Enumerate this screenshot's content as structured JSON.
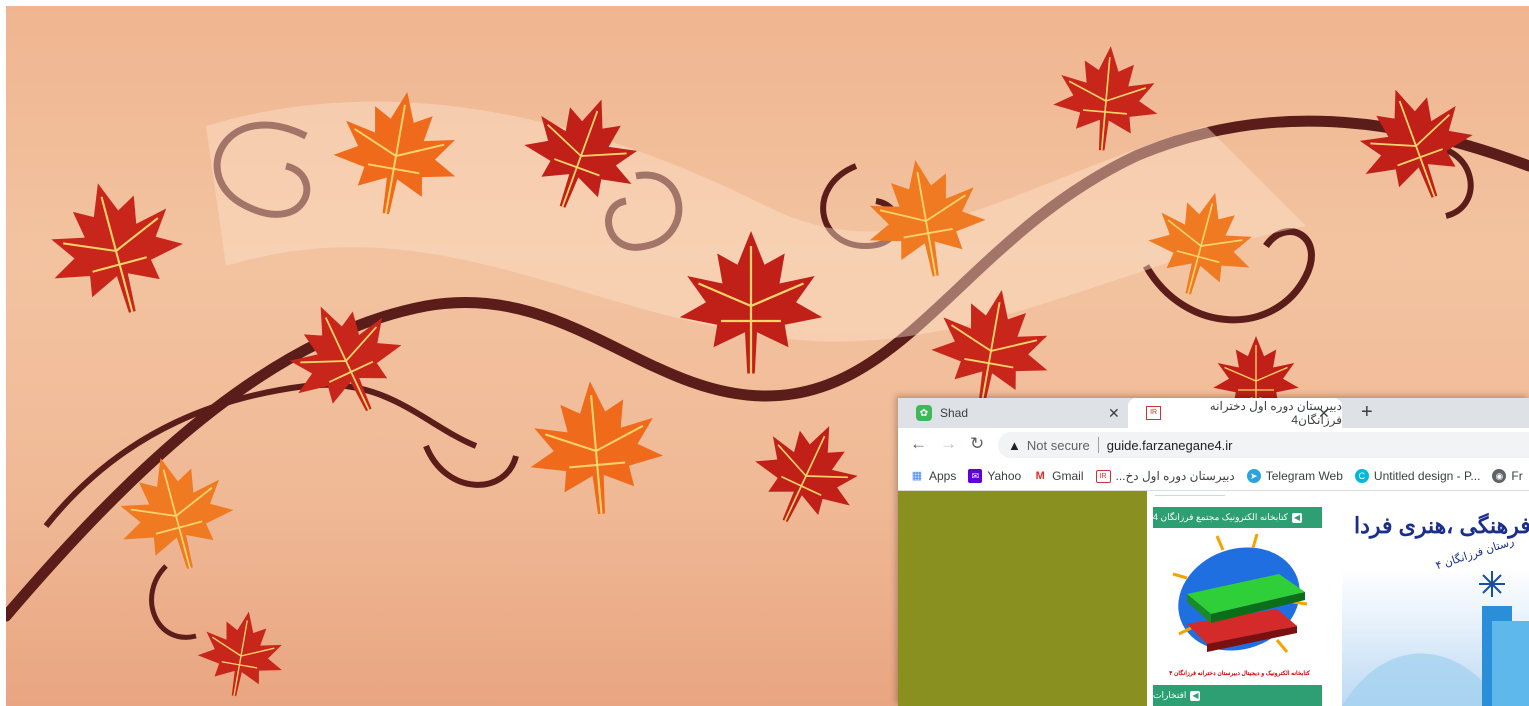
{
  "tabs": [
    {
      "title": "Shad",
      "active": false
    },
    {
      "title": "دبیرستان دوره اول دخترانه فرزانگان4",
      "active": true
    }
  ],
  "toolbar": {
    "security": "Not secure",
    "url": "guide.farzanegane4.ir"
  },
  "bookmarks": [
    {
      "label": "Apps",
      "icon": "apps-grid-icon"
    },
    {
      "label": "Yahoo",
      "icon": "yahoo-mail-icon"
    },
    {
      "label": "Gmail",
      "icon": "gmail-icon"
    },
    {
      "label": "دبیرستان دوره اول دخ...",
      "icon": "site-ir-icon"
    },
    {
      "label": "Telegram Web",
      "icon": "telegram-icon"
    },
    {
      "label": "Untitled design - P...",
      "icon": "canva-icon"
    },
    {
      "label": "Fr",
      "icon": "globe-icon"
    }
  ],
  "sidebar": {
    "library_header": "کتابخانه الکترونیک مجتمع فرزانگان 4",
    "library_caption": "کتابخانه الکترونیک و دیجیتال دبیرستان دخترانه فرزانگان ۴",
    "honors_header": "افتخارات"
  },
  "banner": {
    "title": "قات فرهنگی ،هنری فردا",
    "subtitle": "رستان فرزانگان ۴"
  },
  "colors": {
    "sidebar_header": "#2e9e73",
    "olive_panel": "#8a9020",
    "banner_text": "#1a2e8a"
  }
}
